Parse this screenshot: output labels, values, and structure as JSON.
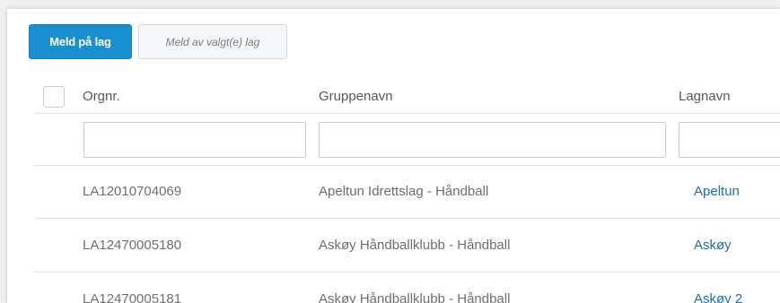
{
  "toolbar": {
    "add_team_label": "Meld på lag",
    "remove_selected_label": "Meld av valgt(e) lag"
  },
  "table": {
    "columns": [
      "Orgnr.",
      "Gruppenavn",
      "Lagnavn"
    ],
    "filters": {
      "orgnr": "",
      "gruppenavn": "",
      "lagnavn": ""
    },
    "rows": [
      {
        "orgnr": "LA12010704069",
        "gruppenavn": "Apeltun Idrettslag - Håndball",
        "lagnavn": "Apeltun"
      },
      {
        "orgnr": "LA12470005180",
        "gruppenavn": "Askøy Håndballklubb - Håndball",
        "lagnavn": "Askøy"
      },
      {
        "orgnr": "LA12470005181",
        "gruppenavn": "Askøy Håndballklubb - Håndball",
        "lagnavn": "Askøy 2"
      }
    ]
  },
  "colors": {
    "primary": "#1a8fd0",
    "link": "#1f6fa8"
  }
}
